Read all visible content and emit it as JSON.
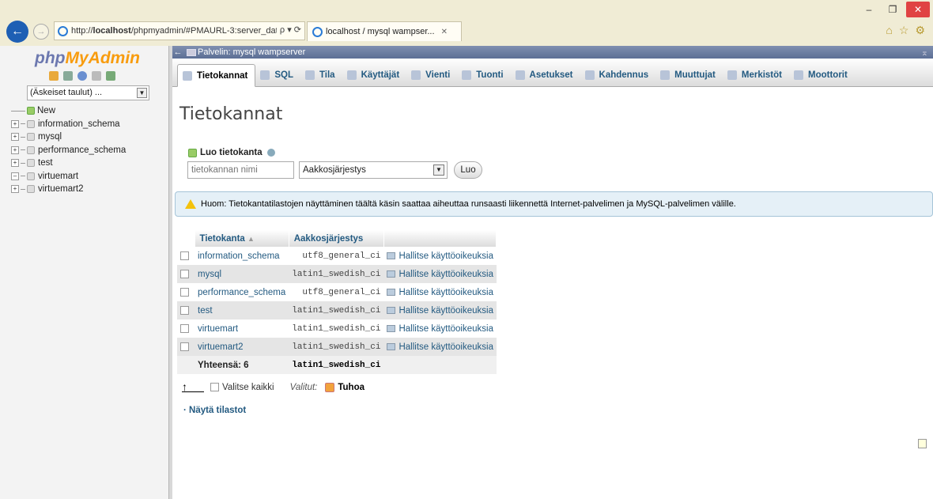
{
  "browser": {
    "url_prefix": "http://",
    "url_host": "localhost",
    "url_path": "/phpmyadmin/#PMAURL-3:server_dat",
    "url_tools": "ρ ▾ ⟳",
    "tab_title": "localhost / mysql wampser...",
    "min": "–",
    "max": "❐",
    "close": "✕",
    "home": "⌂",
    "star": "☆",
    "gear": "⚙"
  },
  "nav": {
    "logo_php": "php",
    "logo_mya": "MyAdmin",
    "recent_tables": "(Äskeiset taulut) ...",
    "tree": [
      {
        "label": "New"
      },
      {
        "label": "information_schema"
      },
      {
        "label": "mysql"
      },
      {
        "label": "performance_schema"
      },
      {
        "label": "test"
      },
      {
        "label": "virtuemart"
      },
      {
        "label": "virtuemart2"
      }
    ]
  },
  "server_bar": {
    "title": "Palvelin: mysql wampserver"
  },
  "menu": [
    {
      "label": "Tietokannat",
      "active": true
    },
    {
      "label": "SQL"
    },
    {
      "label": "Tila"
    },
    {
      "label": "Käyttäjät"
    },
    {
      "label": "Vienti"
    },
    {
      "label": "Tuonti"
    },
    {
      "label": "Asetukset"
    },
    {
      "label": "Kahdennus"
    },
    {
      "label": "Muuttujat"
    },
    {
      "label": "Merkistöt"
    },
    {
      "label": "Moottorit"
    }
  ],
  "page": {
    "title": "Tietokannat",
    "create_label": "Luo tietokanta",
    "db_name_placeholder": "tietokannan nimi",
    "collation_value": "Aakkosjärjestys",
    "create_button": "Luo",
    "notice": "Huom: Tietokantatilastojen näyttäminen täältä käsin saattaa aiheuttaa runsaasti liikennettä Internet-palvelimen ja MySQL-palvelimen välille."
  },
  "table": {
    "headers": [
      "Tietokanta",
      "Aakkosjärjestys"
    ],
    "rows": [
      {
        "name": "information_schema",
        "collation": "utf8_general_ci",
        "privs": "Hallitse käyttöoikeuksia"
      },
      {
        "name": "mysql",
        "collation": "latin1_swedish_ci",
        "privs": "Hallitse käyttöoikeuksia"
      },
      {
        "name": "performance_schema",
        "collation": "utf8_general_ci",
        "privs": "Hallitse käyttöoikeuksia"
      },
      {
        "name": "test",
        "collation": "latin1_swedish_ci",
        "privs": "Hallitse käyttöoikeuksia"
      },
      {
        "name": "virtuemart",
        "collation": "latin1_swedish_ci",
        "privs": "Hallitse käyttöoikeuksia"
      },
      {
        "name": "virtuemart2",
        "collation": "latin1_swedish_ci",
        "privs": "Hallitse käyttöoikeuksia"
      }
    ],
    "total_label": "Yhteensä: 6",
    "total_collation": "latin1_swedish_ci"
  },
  "footer": {
    "select_all": "Valitse kaikki",
    "with_selected": "Valitut:",
    "drop": "Tuhoa",
    "show_stats": "Näytä tilastot"
  },
  "colors": {
    "accent": "#235a81",
    "server_bar": "#5c6f95",
    "notice_bg": "#e5f0f7"
  }
}
